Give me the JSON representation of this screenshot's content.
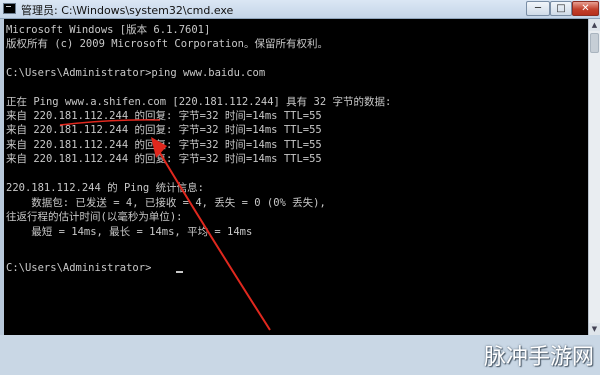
{
  "window": {
    "title": "管理员: C:\\Windows\\system32\\cmd.exe",
    "controls": {
      "minimize": "─",
      "maximize": "□",
      "close": "✕"
    }
  },
  "console": {
    "lines": [
      "Microsoft Windows [版本 6.1.7601]",
      "版权所有 (c) 2009 Microsoft Corporation。保留所有权利。",
      "",
      "C:\\Users\\Administrator>ping www.baidu.com",
      "",
      "正在 Ping www.a.shifen.com [220.181.112.244] 具有 32 字节的数据:",
      "来自 220.181.112.244 的回复: 字节=32 时间=14ms TTL=55",
      "来自 220.181.112.244 的回复: 字节=32 时间=14ms TTL=55",
      "来自 220.181.112.244 的回复: 字节=32 时间=14ms TTL=55",
      "来自 220.181.112.244 的回复: 字节=32 时间=14ms TTL=55",
      "",
      "220.181.112.244 的 Ping 统计信息:",
      "    数据包: 已发送 = 4, 已接收 = 4, 丢失 = 0 (0% 丢失),",
      "往返行程的估计时间(以毫秒为单位):",
      "    最短 = 14ms, 最长 = 14ms, 平均 = 14ms",
      "",
      "",
      "C:\\Users\\Administrator>"
    ]
  },
  "annotation": {
    "color": "#e0281e"
  },
  "watermark": "脉冲手游网"
}
